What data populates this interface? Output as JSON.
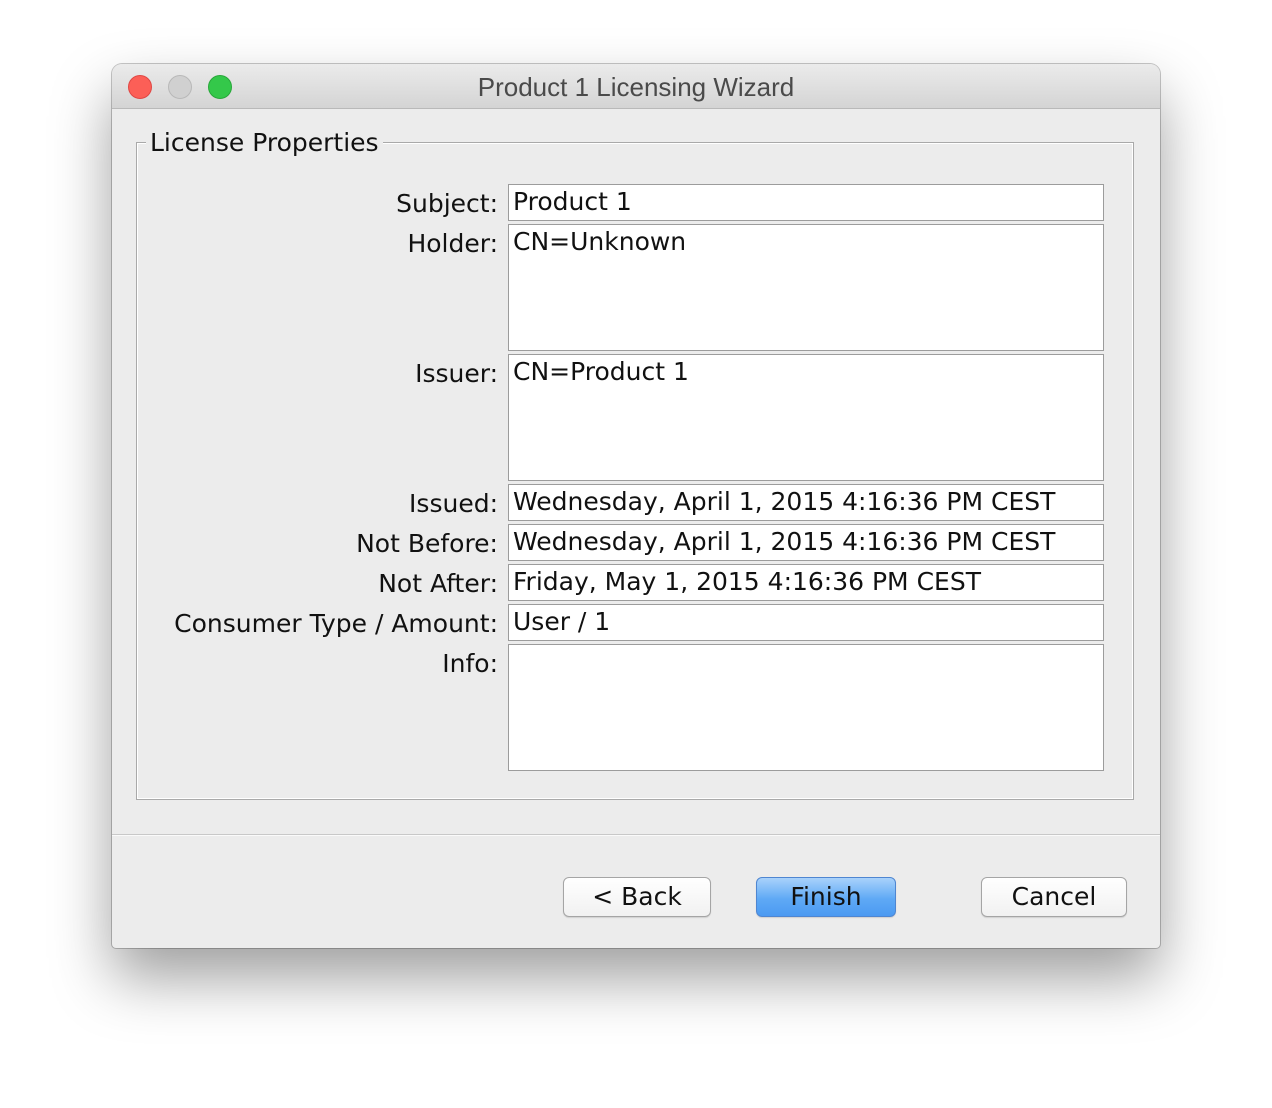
{
  "window": {
    "title": "Product 1 Licensing Wizard"
  },
  "group": {
    "title": "License Properties"
  },
  "fields": {
    "subject": {
      "label": "Subject:",
      "value": "Product 1"
    },
    "holder": {
      "label": "Holder:",
      "value": "CN=Unknown"
    },
    "issuer": {
      "label": "Issuer:",
      "value": "CN=Product 1"
    },
    "issued": {
      "label": "Issued:",
      "value": "Wednesday, April 1, 2015 4:16:36 PM CEST"
    },
    "not_before": {
      "label": "Not Before:",
      "value": "Wednesday, April 1, 2015 4:16:36 PM CEST"
    },
    "not_after": {
      "label": "Not After:",
      "value": "Friday, May 1, 2015 4:16:36 PM CEST"
    },
    "consumer": {
      "label": "Consumer Type / Amount:",
      "value": "User / 1"
    },
    "info": {
      "label": "Info:",
      "value": ""
    }
  },
  "buttons": {
    "back": "< Back",
    "finish": "Finish",
    "cancel": "Cancel"
  },
  "colors": {
    "close": "#fc5f57",
    "minimize": "#d0d0d0",
    "maximize": "#34c84a",
    "primary_button": "#5fa9f5"
  }
}
